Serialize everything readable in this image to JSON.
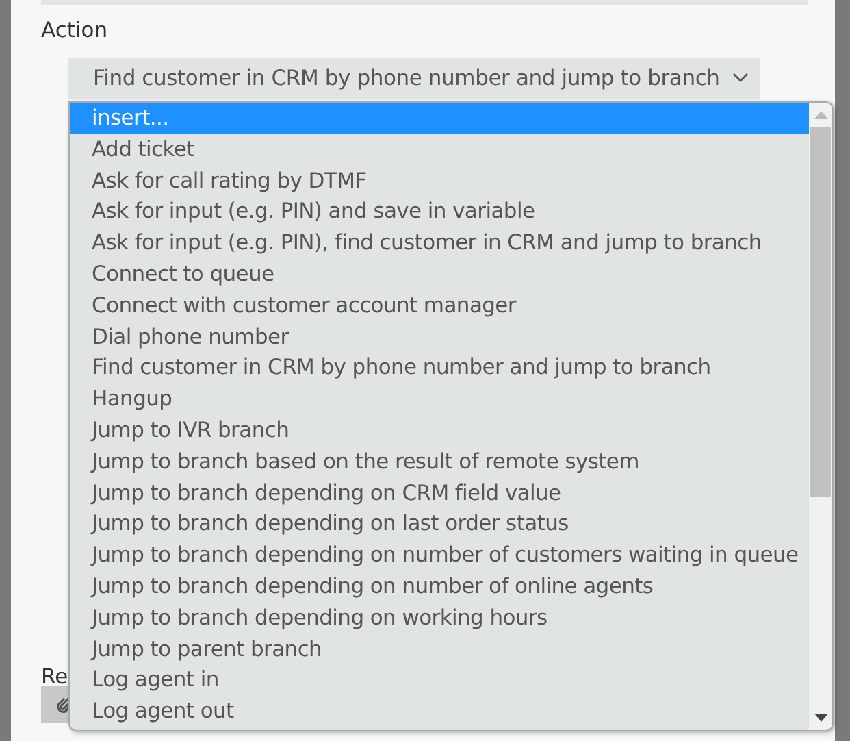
{
  "action_label": "Action",
  "action_select": {
    "value": "Find customer in CRM by phone number and jump to branch"
  },
  "dropdown_options": [
    {
      "label": "insert...",
      "selected": true
    },
    {
      "label": "Add ticket",
      "selected": false
    },
    {
      "label": "Ask for call rating by DTMF",
      "selected": false
    },
    {
      "label": "Ask for input (e.g. PIN) and save in variable",
      "selected": false
    },
    {
      "label": "Ask for input (e.g. PIN), find customer in CRM and jump to branch",
      "selected": false
    },
    {
      "label": "Connect to queue",
      "selected": false
    },
    {
      "label": "Connect with customer account manager",
      "selected": false
    },
    {
      "label": "Dial phone number",
      "selected": false
    },
    {
      "label": "Find customer in CRM by phone number and jump to branch",
      "selected": false
    },
    {
      "label": "Hangup",
      "selected": false
    },
    {
      "label": "Jump to IVR branch",
      "selected": false
    },
    {
      "label": "Jump to branch based on the result of remote system",
      "selected": false
    },
    {
      "label": "Jump to branch depending on CRM field value",
      "selected": false
    },
    {
      "label": "Jump to branch depending on last order status",
      "selected": false
    },
    {
      "label": "Jump to branch depending on number of customers waiting in queue",
      "selected": false
    },
    {
      "label": "Jump to branch depending on number of online agents",
      "selected": false
    },
    {
      "label": "Jump to branch depending on working hours",
      "selected": false
    },
    {
      "label": "Jump to parent branch",
      "selected": false
    },
    {
      "label": "Log agent in",
      "selected": false
    },
    {
      "label": "Log agent out",
      "selected": false
    }
  ],
  "partial_label": "Re"
}
